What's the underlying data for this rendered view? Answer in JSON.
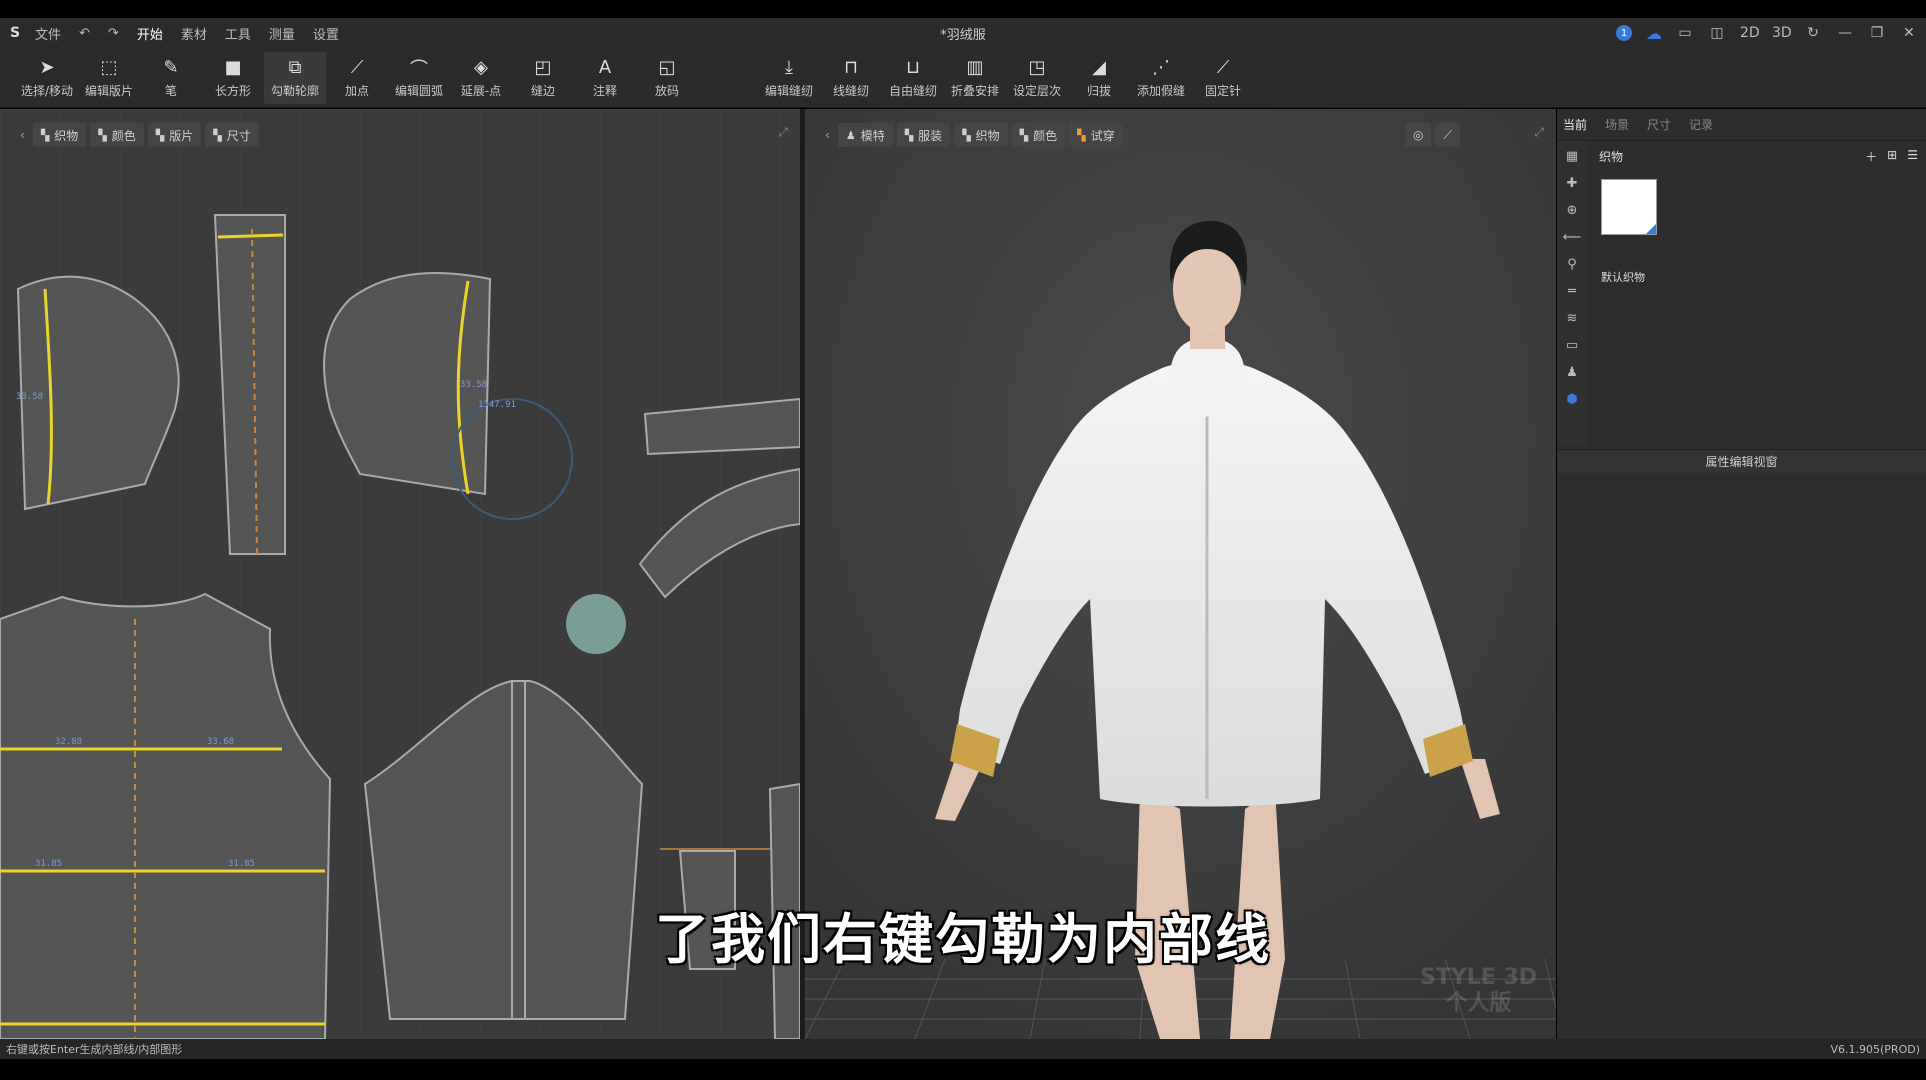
{
  "menu": {
    "items": [
      "文件",
      "开始",
      "素材",
      "工具",
      "测量",
      "设置"
    ],
    "active": "开始",
    "title": "*羽绒服"
  },
  "title_right": {
    "notification_count": "1",
    "view_2d": "2D",
    "view_3d": "3D"
  },
  "toolbar": {
    "tools": [
      {
        "label": "选择/移动",
        "icon": "pointer-icon"
      },
      {
        "label": "编辑版片",
        "icon": "edit-pattern-icon"
      },
      {
        "label": "笔",
        "icon": "pen-icon"
      },
      {
        "label": "长方形",
        "icon": "rectangle-icon"
      },
      {
        "label": "勾勒轮廓",
        "icon": "trace-outline-icon"
      },
      {
        "label": "加点",
        "icon": "add-point-icon"
      },
      {
        "label": "编辑圆弧",
        "icon": "edit-arc-icon"
      },
      {
        "label": "延展-点",
        "icon": "extend-point-icon"
      },
      {
        "label": "缝边",
        "icon": "seam-allowance-icon"
      },
      {
        "label": "注释",
        "icon": "annotation-icon"
      },
      {
        "label": "放码",
        "icon": "grading-icon"
      }
    ],
    "tools_right": [
      {
        "label": "编辑缝纫",
        "icon": "edit-sewing-icon"
      },
      {
        "label": "线缝纫",
        "icon": "line-sewing-icon"
      },
      {
        "label": "自由缝纫",
        "icon": "free-sewing-icon"
      },
      {
        "label": "折叠安排",
        "icon": "fold-arrange-icon"
      },
      {
        "label": "设定层次",
        "icon": "set-layer-icon"
      },
      {
        "label": "归拔",
        "icon": "shrink-icon"
      },
      {
        "label": "添加假缝",
        "icon": "add-tack-icon"
      },
      {
        "label": "固定针",
        "icon": "pin-icon"
      }
    ],
    "active_tool": "勾勒轮廓"
  },
  "panel2d": {
    "tabs": [
      "织物",
      "颜色",
      "版片",
      "尺寸"
    ]
  },
  "panel3d": {
    "tabs": [
      "模特",
      "服装",
      "织物",
      "颜色",
      "试穿"
    ]
  },
  "right_panel": {
    "tabs": [
      "当前",
      "场景",
      "尺寸",
      "记录"
    ],
    "active_tab": "当前",
    "section_title": "织物",
    "swatch_label": "默认织物",
    "property_header": "属性编辑视窗"
  },
  "measurements": {
    "labels": [
      "1347.91",
      "33.58",
      "33.58",
      "32.88",
      "33.68",
      "31.85",
      "31.85"
    ]
  },
  "subtitle": "了我们右键勾勒为内部线",
  "watermark": [
    "STYLE 3D",
    "个人版"
  ],
  "statusbar": {
    "hint": "右键或按Enter生成内部线/内部图形",
    "version": "V6.1.905(PROD)"
  },
  "colors": {
    "accent": "#3a7ad9",
    "pattern_highlight": "#e8d42a",
    "cuff": "#c9a24a"
  }
}
